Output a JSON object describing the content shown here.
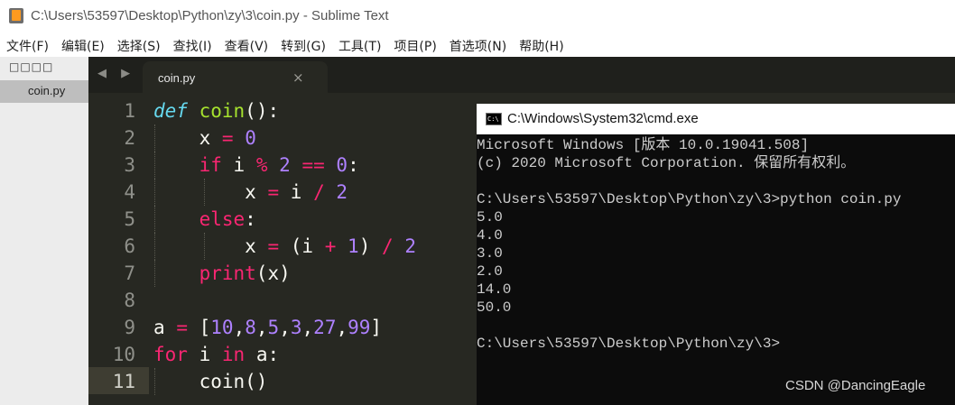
{
  "window": {
    "title": "C:\\Users\\53597\\Desktop\\Python\\zy\\3\\coin.py - Sublime Text"
  },
  "menu": [
    "文件(F)",
    "编辑(E)",
    "选择(S)",
    "查找(I)",
    "查看(V)",
    "转到(G)",
    "工具(T)",
    "项目(P)",
    "首选项(N)",
    "帮助(H)"
  ],
  "sidebar": {
    "header": "□□□□",
    "file": "coin.py"
  },
  "tabs": {
    "nav": "◀ ▶",
    "active_label": "coin.py",
    "close_glyph": "×"
  },
  "editor": {
    "line_numbers": [
      "1",
      "2",
      "3",
      "4",
      "5",
      "6",
      "7",
      "8",
      "9",
      "10",
      "11"
    ],
    "active_line": 11,
    "code": {
      "l1": {
        "kw": "def",
        "name": "coin",
        "punct": "():"
      },
      "l2": {
        "var": "x",
        "op": "=",
        "num": "0"
      },
      "l3": {
        "kw": "if",
        "var": "i",
        "op": "%",
        "num": "2",
        "op2": "==",
        "num2": "0",
        "punct": ":"
      },
      "l4": {
        "var": "x",
        "op": "=",
        "var2": "i",
        "op2": "/",
        "num": "2"
      },
      "l5": {
        "kw": "else",
        "punct": ":"
      },
      "l6": {
        "var": "x",
        "op": "=",
        "open": "(i",
        "op2": "+",
        "num": "1",
        "close": ")",
        "op3": "/",
        "num2": "2"
      },
      "l7": {
        "builtin": "print",
        "args": "(x)"
      },
      "l9": {
        "var": "a",
        "op": "=",
        "open": "[",
        "nums": [
          "10",
          "8",
          "5",
          "3",
          "27",
          "99"
        ],
        "close": "]"
      },
      "l10": {
        "kw": "for",
        "var": "i",
        "kw2": "in",
        "var2": "a:"
      },
      "l11": {
        "call": "coin()"
      }
    }
  },
  "cmd": {
    "title": "C:\\Windows\\System32\\cmd.exe",
    "lines": [
      "Microsoft Windows [版本 10.0.19041.508]",
      "(c) 2020 Microsoft Corporation. 保留所有权利。",
      "",
      "C:\\Users\\53597\\Desktop\\Python\\zy\\3>python coin.py",
      "5.0",
      "4.0",
      "3.0",
      "2.0",
      "14.0",
      "50.0",
      "",
      "C:\\Users\\53597\\Desktop\\Python\\zy\\3>"
    ]
  },
  "watermark": "CSDN @DancingEagle"
}
